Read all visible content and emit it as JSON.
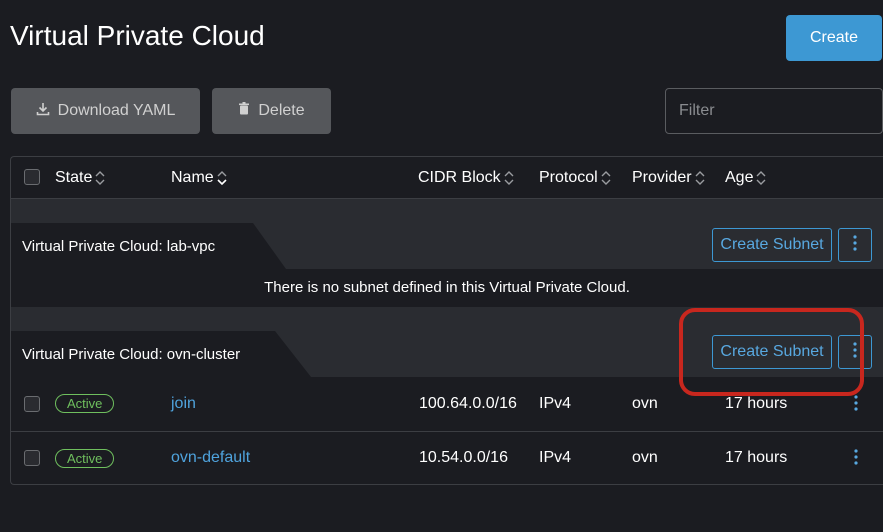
{
  "header": {
    "title": "Virtual Private Cloud",
    "create_label": "Create"
  },
  "toolbar": {
    "download_label": "Download YAML",
    "delete_label": "Delete",
    "filter_placeholder": "Filter"
  },
  "table": {
    "columns": [
      "State",
      "Name",
      "CIDR Block",
      "Protocol",
      "Provider",
      "Age"
    ],
    "groups": [
      {
        "label": "Virtual Private Cloud: lab-vpc",
        "create_subnet_label": "Create Subnet",
        "empty_message": "There is no subnet defined in this Virtual Private Cloud."
      },
      {
        "label": "Virtual Private Cloud: ovn-cluster",
        "create_subnet_label": "Create Subnet",
        "rows": [
          {
            "state": "Active",
            "name": "join",
            "cidr": "100.64.0.0/16",
            "protocol": "IPv4",
            "provider": "ovn",
            "age": "17 hours"
          },
          {
            "state": "Active",
            "name": "ovn-default",
            "cidr": "10.54.0.0/16",
            "protocol": "IPv4",
            "provider": "ovn",
            "age": "17 hours"
          }
        ]
      }
    ]
  },
  "colors": {
    "accent": "#3d98d3",
    "status_active": "#6fbf5e",
    "highlight": "#c8271e"
  }
}
